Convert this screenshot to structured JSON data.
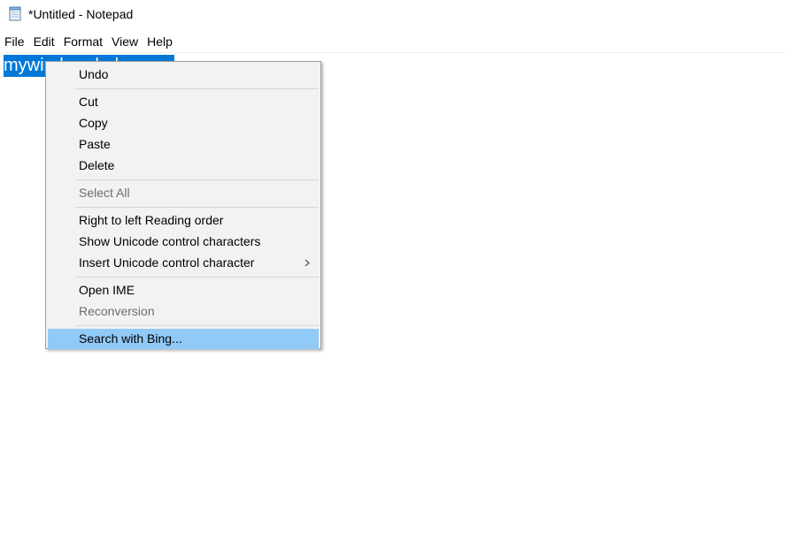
{
  "window": {
    "title": "*Untitled - Notepad"
  },
  "menubar": {
    "items": [
      "File",
      "Edit",
      "Format",
      "View",
      "Help"
    ]
  },
  "editor": {
    "selected_text": "mywindowshub.com"
  },
  "context_menu": {
    "undo": "Undo",
    "cut": "Cut",
    "copy": "Copy",
    "paste": "Paste",
    "delete": "Delete",
    "select_all": "Select All",
    "rtl_reading_order": "Right to left Reading order",
    "show_unicode": "Show Unicode control characters",
    "insert_unicode": "Insert Unicode control character",
    "open_ime": "Open IME",
    "reconversion": "Reconversion",
    "search_bing": "Search with Bing..."
  },
  "colors": {
    "selection": "#0078d7",
    "menu_highlight": "#91c9f7",
    "menu_background": "#f2f2f2",
    "disabled_text": "#6d6d6d"
  },
  "icons": {
    "app": "notepad-icon",
    "submenu": "chevron-right-icon"
  }
}
